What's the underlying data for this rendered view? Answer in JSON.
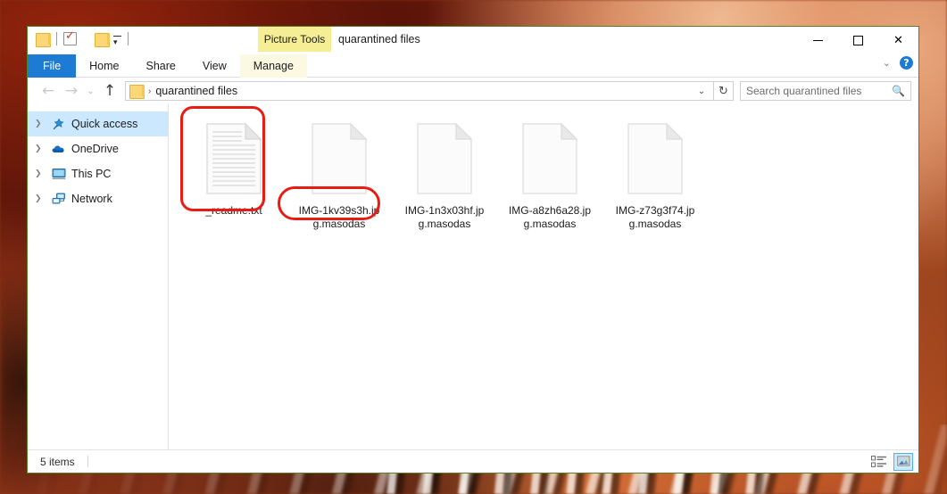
{
  "window": {
    "title": "quarantined files",
    "contextual_tab_group": "Picture Tools",
    "controls": {
      "minimize": "minimize-button",
      "maximize": "maximize-button",
      "close": "✕"
    },
    "ribbon_expand": "⌄",
    "help": "?"
  },
  "quick_access_toolbar": {
    "items": [
      "folder-icon",
      "properties-icon",
      "new-folder-icon"
    ],
    "customize_caret": "▾"
  },
  "ribbon": {
    "tabs": [
      {
        "label": "File",
        "state": "active-file"
      },
      {
        "label": "Home",
        "state": "normal"
      },
      {
        "label": "Share",
        "state": "normal"
      },
      {
        "label": "View",
        "state": "normal"
      },
      {
        "label": "Manage",
        "state": "contextual"
      }
    ]
  },
  "address_bar": {
    "back": "←",
    "forward": "→",
    "recent": "⌄",
    "up": "↑",
    "breadcrumb_icon": "folder-icon",
    "breadcrumb_sep": "›",
    "path": "quarantined files",
    "dropdown": "⌄",
    "refresh": "↻"
  },
  "search": {
    "placeholder": "Search quarantined files",
    "icon": "search-icon"
  },
  "sidebar": {
    "items": [
      {
        "label": "Quick access",
        "icon": "star-pin-icon",
        "selected": true
      },
      {
        "label": "OneDrive",
        "icon": "cloud-icon",
        "selected": false
      },
      {
        "label": "This PC",
        "icon": "monitor-icon",
        "selected": false
      },
      {
        "label": "Network",
        "icon": "network-icon",
        "selected": false
      }
    ]
  },
  "files": [
    {
      "name": "_readme.txt",
      "icon": "text-document-icon",
      "annotated": true
    },
    {
      "name": "IMG-1kv39s3h.jpg.masodas",
      "icon": "blank-document-icon",
      "annotated": true
    },
    {
      "name": "IMG-1n3x03hf.jpg.masodas",
      "icon": "blank-document-icon",
      "annotated": false
    },
    {
      "name": "IMG-a8zh6a28.jpg.masodas",
      "icon": "blank-document-icon",
      "annotated": false
    },
    {
      "name": "IMG-z73g3f74.jpg.masodas",
      "icon": "blank-document-icon",
      "annotated": false
    }
  ],
  "status_bar": {
    "item_count": "5 items",
    "views": [
      {
        "name": "details-view",
        "active": false
      },
      {
        "name": "large-icons-view",
        "active": true
      }
    ]
  },
  "colors": {
    "file_tab_blue": "#1e7bd4",
    "contextual_yellow": "#f5ee94",
    "selection_blue": "#cce8ff",
    "annotation_red": "#e81c12",
    "window_border_green": "#55812c"
  }
}
